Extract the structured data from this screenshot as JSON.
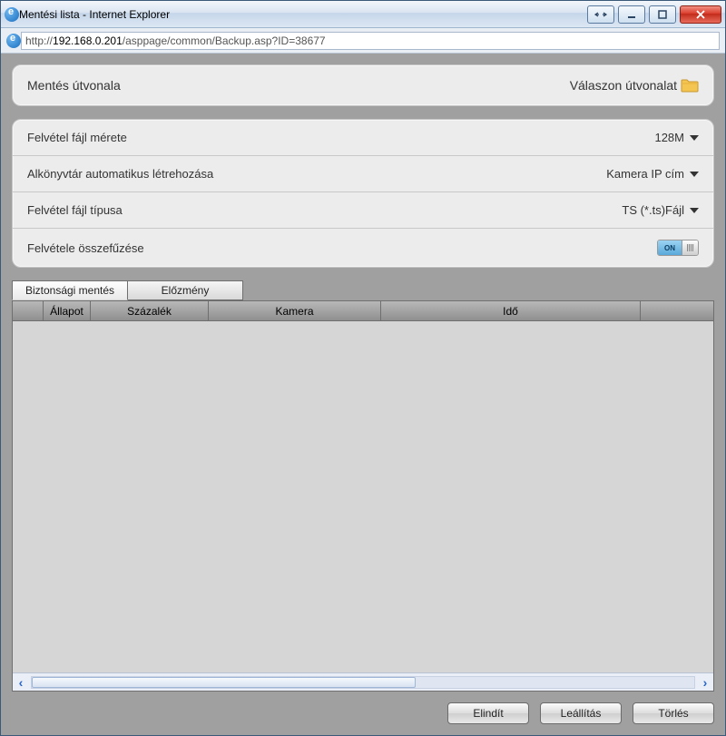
{
  "window": {
    "title": "Mentési lista - Internet Explorer"
  },
  "address": {
    "prefix": "http://",
    "host": "192.168.0.201",
    "path": "/asppage/common/Backup.asp?ID=38677"
  },
  "path_panel": {
    "label": "Mentés útvonala",
    "choose": "Válaszon útvonalat"
  },
  "settings": {
    "file_size": {
      "label": "Felvétel fájl mérete",
      "value": "128M"
    },
    "subdir": {
      "label": "Alkönyvtár automatikus létrehozása",
      "value": "Kamera IP cím"
    },
    "file_type": {
      "label": "Felvétel fájl típusa",
      "value": "TS (*.ts)Fájl"
    },
    "merge": {
      "label": "Felvétele összefűzése",
      "state": "ON"
    }
  },
  "tabs": {
    "backup": "Biztonsági mentés",
    "history": "Előzmény"
  },
  "grid": {
    "columns": {
      "checkbox": "",
      "state": "Állapot",
      "percent": "Százalék",
      "camera": "Kamera",
      "time": "Idő",
      "extra": ""
    },
    "rows": []
  },
  "buttons": {
    "start": "Elindít",
    "stop": "Leállítás",
    "delete": "Törlés"
  }
}
